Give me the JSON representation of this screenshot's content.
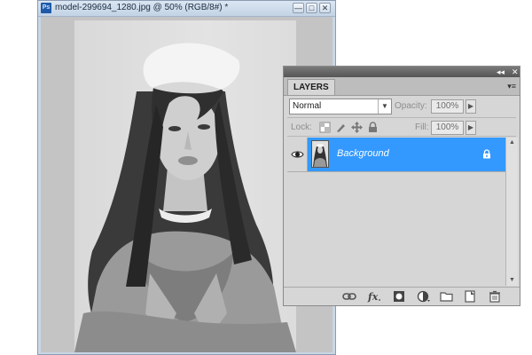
{
  "document": {
    "title": "model-299694_1280.jpg @ 50% (RGB/8#) *",
    "app_icon_label": "Ps",
    "controls": [
      "—",
      "□",
      "✕"
    ]
  },
  "layers_panel": {
    "collapse_glyph": "◂◂",
    "close_glyph": "✕",
    "tab_label": "LAYERS",
    "menu_glyph": "▾≡",
    "blend_mode": "Normal",
    "opacity_label": "Opacity:",
    "opacity_value": "100%",
    "lock_label": "Lock:",
    "fill_label": "Fill:",
    "fill_value": "100%",
    "layers": [
      {
        "name": "Background",
        "visible": true,
        "locked": true,
        "selected": true
      }
    ],
    "bottom_icons": [
      "link-icon",
      "fx-icon",
      "mask-icon",
      "adjustment-icon",
      "folder-icon",
      "new-layer-icon",
      "trash-icon"
    ]
  }
}
